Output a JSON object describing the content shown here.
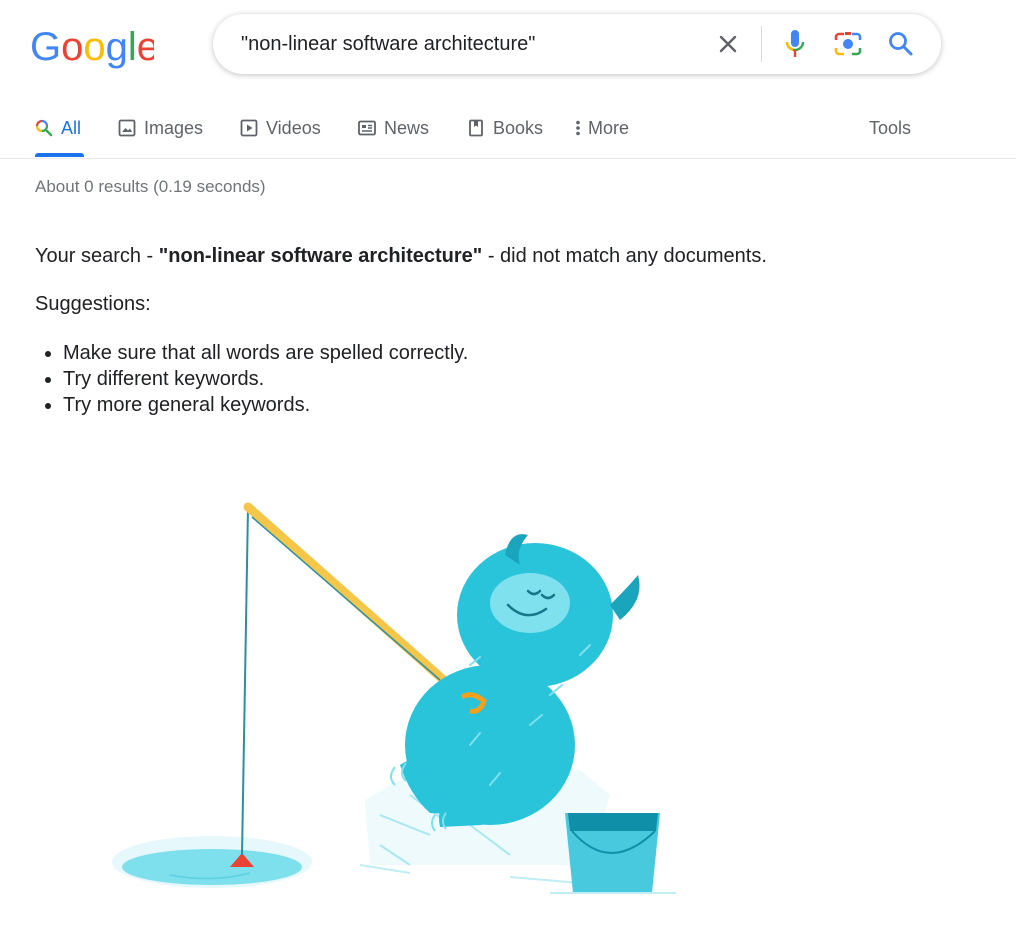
{
  "header": {
    "logo_text": "Google",
    "search": {
      "query": "\"non-linear software architecture\""
    }
  },
  "tabs": [
    {
      "label": "All",
      "icon": "search-icon",
      "active": true
    },
    {
      "label": "Images",
      "icon": "image-icon"
    },
    {
      "label": "Videos",
      "icon": "play-icon"
    },
    {
      "label": "News",
      "icon": "newspaper-icon"
    },
    {
      "label": "Books",
      "icon": "book-icon"
    },
    {
      "label": "More",
      "icon": "more-vert-icon"
    }
  ],
  "tools_label": "Tools",
  "results": {
    "stats": "About 0 results (0.19 seconds)",
    "no_match_prefix": "Your search - ",
    "no_match_query": "\"non-linear software architecture\"",
    "no_match_suffix": " - did not match any documents.",
    "suggestions_title": "Suggestions:",
    "suggestions": [
      "Make sure that all words are spelled correctly.",
      "Try different keywords.",
      "Try more general keywords."
    ]
  },
  "colors": {
    "google_blue": "#4285f4",
    "google_red": "#ea4335",
    "google_yellow": "#fbbc05",
    "google_green": "#34a853",
    "accent": "#1a73e8",
    "monster": "#29c4da"
  }
}
